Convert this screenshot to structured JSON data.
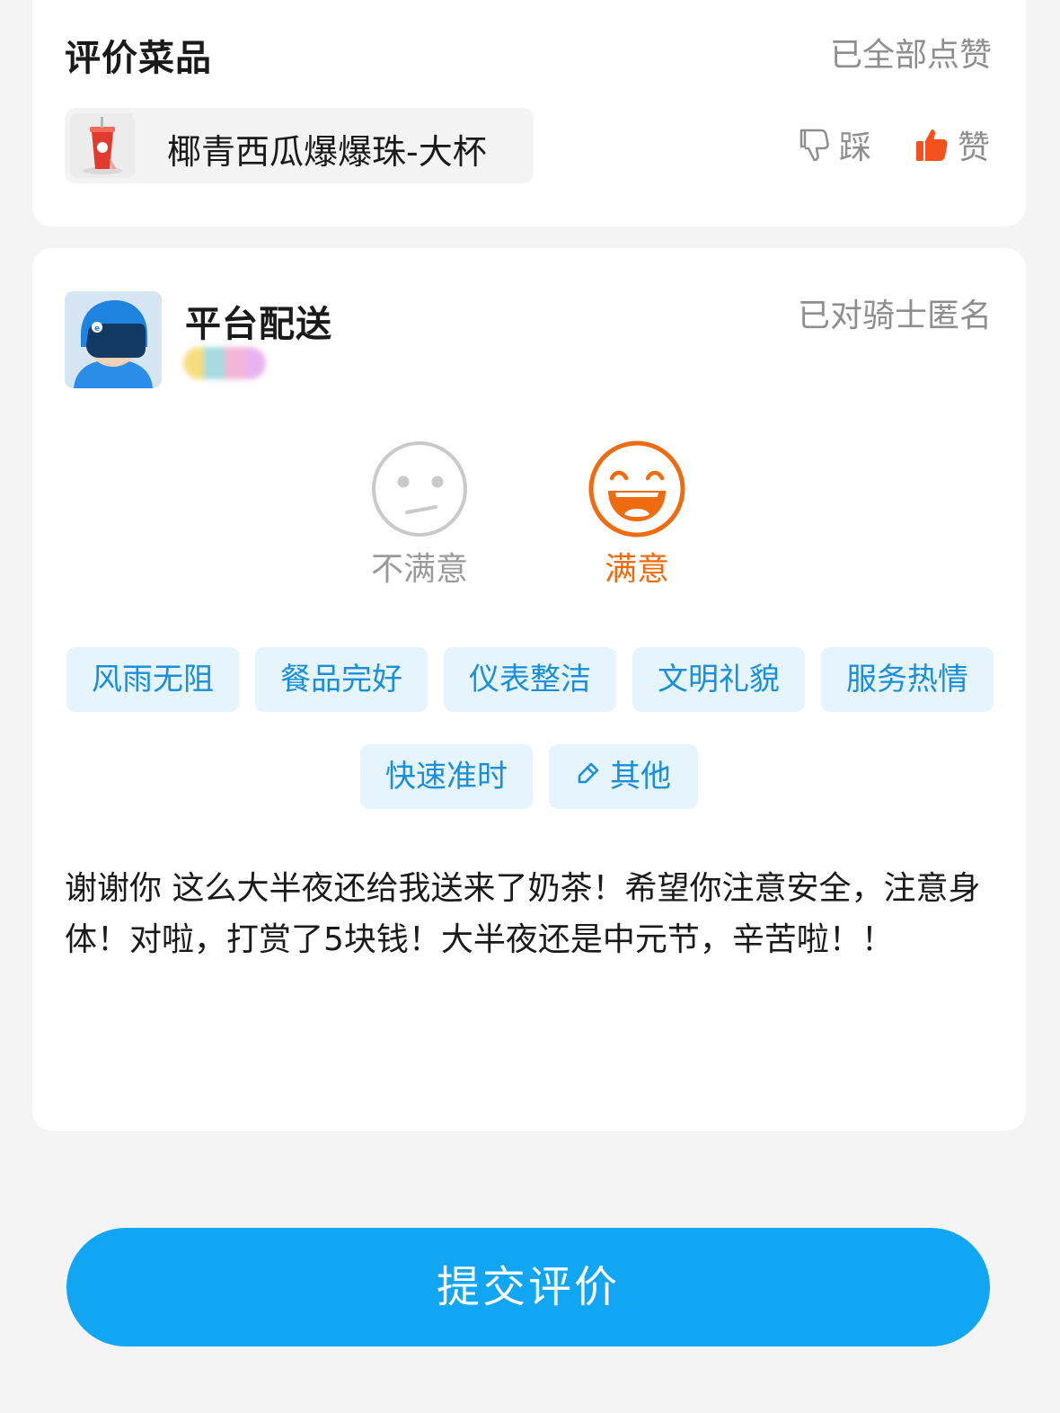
{
  "dish_section": {
    "title": "评价菜品",
    "status": "已全部点赞",
    "dish": {
      "name": "椰青西瓜爆爆珠-大杯",
      "thumbnail": "drink-cup-image"
    },
    "dislike_label": "踩",
    "like_label": "赞",
    "like_selected": true,
    "like_color": "#f4511e"
  },
  "delivery_section": {
    "title": "平台配送",
    "anonymous_status": "已对骑士匿名",
    "rider_avatar": "rider-helmet-avatar",
    "ratings": [
      {
        "label": "不满意",
        "icon": "neutral-face-icon",
        "selected": false
      },
      {
        "label": "满意",
        "icon": "laughing-face-icon",
        "selected": true
      }
    ],
    "selected_color": "#ef6b0f",
    "tags": [
      {
        "label": "风雨无阻"
      },
      {
        "label": "餐品完好"
      },
      {
        "label": "仪表整洁"
      },
      {
        "label": "文明礼貌"
      },
      {
        "label": "服务热情"
      },
      {
        "label": "快速准时"
      },
      {
        "label": "其他",
        "icon": "pencil-icon"
      }
    ],
    "tag_color": "#1a8fd9",
    "comment": "谢谢你 这么大半夜还给我送来了奶茶！希望你注意安全，注意身体！对啦，打赏了5块钱！大半夜还是中元节，辛苦啦！！"
  },
  "submit": {
    "label": "提交评价",
    "color": "#11a6f4"
  }
}
